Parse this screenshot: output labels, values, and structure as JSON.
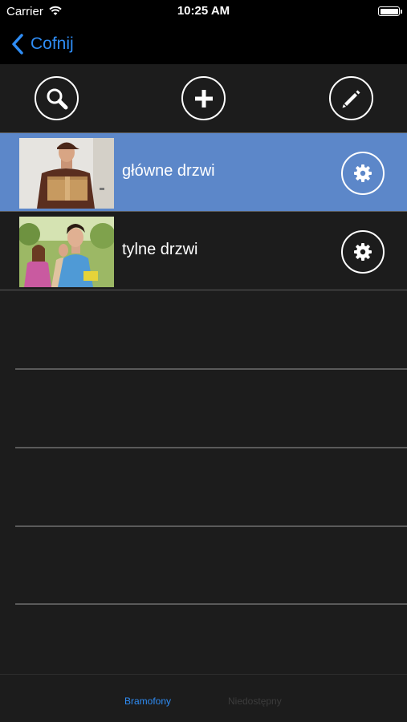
{
  "status_bar": {
    "carrier": "Carrier",
    "time": "10:25 AM"
  },
  "nav": {
    "back_label": "Cofnij"
  },
  "toolbar": {
    "buttons": [
      "search-icon",
      "plus-icon",
      "pencil-icon"
    ]
  },
  "doors": [
    {
      "label": "główne drzwi",
      "selected": true
    },
    {
      "label": "tylne drzwi",
      "selected": false
    }
  ],
  "tabs": [
    {
      "label": "Bramofony",
      "active": true
    },
    {
      "label": "Niedostępny",
      "active": false
    }
  ],
  "colors": {
    "accent": "#2f8df5",
    "selected_row": "#5c87c9",
    "background": "#1c1c1c",
    "bar": "#000000"
  }
}
